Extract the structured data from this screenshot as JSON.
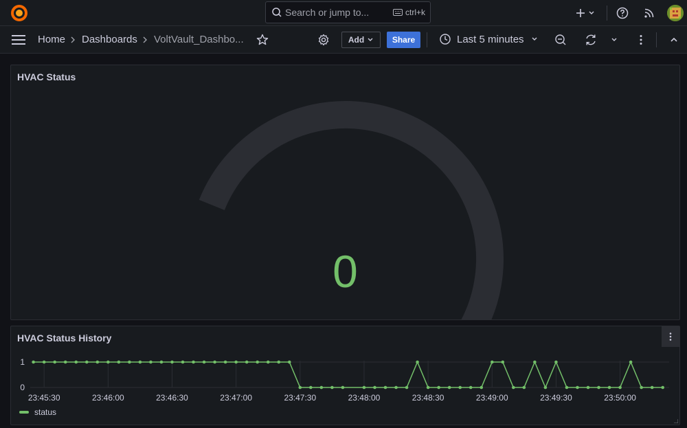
{
  "topbar": {
    "search_placeholder": "Search or jump to...",
    "search_shortcut": "ctrl+k"
  },
  "nav": {
    "breadcrumbs": [
      "Home",
      "Dashboards",
      "VoltVault_Dashbo..."
    ],
    "add_label": "Add",
    "share_label": "Share",
    "time_range": "Last 5 minutes"
  },
  "gauge_panel": {
    "title": "HVAC Status",
    "value": "0",
    "gauge_fraction": 0,
    "colors": {
      "track": "#2b2d33",
      "value": "#73bf69"
    }
  },
  "history_panel": {
    "title": "HVAC Status History",
    "legend": "status"
  },
  "chart_data": {
    "type": "line",
    "title": "HVAC Status History",
    "x_ticks": [
      "23:45:30",
      "23:46:00",
      "23:46:30",
      "23:47:00",
      "23:47:30",
      "23:48:00",
      "23:48:30",
      "23:49:00",
      "23:49:30",
      "23:50:00"
    ],
    "y_ticks": [
      "0",
      "1"
    ],
    "ylim": [
      0,
      1
    ],
    "grid": true,
    "legend_position": "bottom-left",
    "series": [
      {
        "name": "status",
        "color": "#73bf69",
        "points": [
          [
            "23:45:25",
            1
          ],
          [
            "23:45:30",
            1
          ],
          [
            "23:45:35",
            1
          ],
          [
            "23:45:40",
            1
          ],
          [
            "23:45:45",
            1
          ],
          [
            "23:45:50",
            1
          ],
          [
            "23:45:55",
            1
          ],
          [
            "23:46:00",
            1
          ],
          [
            "23:46:05",
            1
          ],
          [
            "23:46:10",
            1
          ],
          [
            "23:46:15",
            1
          ],
          [
            "23:46:20",
            1
          ],
          [
            "23:46:25",
            1
          ],
          [
            "23:46:30",
            1
          ],
          [
            "23:46:35",
            1
          ],
          [
            "23:46:40",
            1
          ],
          [
            "23:46:45",
            1
          ],
          [
            "23:46:50",
            1
          ],
          [
            "23:46:55",
            1
          ],
          [
            "23:47:00",
            1
          ],
          [
            "23:47:05",
            1
          ],
          [
            "23:47:10",
            1
          ],
          [
            "23:47:15",
            1
          ],
          [
            "23:47:20",
            1
          ],
          [
            "23:47:25",
            1
          ],
          [
            "23:47:30",
            0
          ],
          [
            "23:47:35",
            0
          ],
          [
            "23:47:40",
            0
          ],
          [
            "23:47:45",
            0
          ],
          [
            "23:47:50",
            0
          ],
          [
            "23:48:00",
            0
          ],
          [
            "23:48:05",
            0
          ],
          [
            "23:48:10",
            0
          ],
          [
            "23:48:15",
            0
          ],
          [
            "23:48:20",
            0
          ],
          [
            "23:48:25",
            1
          ],
          [
            "23:48:30",
            0
          ],
          [
            "23:48:35",
            0
          ],
          [
            "23:48:40",
            0
          ],
          [
            "23:48:45",
            0
          ],
          [
            "23:48:50",
            0
          ],
          [
            "23:48:55",
            0
          ],
          [
            "23:49:00",
            1
          ],
          [
            "23:49:05",
            1
          ],
          [
            "23:49:10",
            0
          ],
          [
            "23:49:15",
            0
          ],
          [
            "23:49:20",
            1
          ],
          [
            "23:49:25",
            0
          ],
          [
            "23:49:30",
            1
          ],
          [
            "23:49:35",
            0
          ],
          [
            "23:49:40",
            0
          ],
          [
            "23:49:45",
            0
          ],
          [
            "23:49:50",
            0
          ],
          [
            "23:49:55",
            0
          ],
          [
            "23:50:00",
            0
          ],
          [
            "23:50:05",
            1
          ],
          [
            "23:50:10",
            0
          ],
          [
            "23:50:15",
            0
          ],
          [
            "23:50:20",
            0
          ]
        ]
      }
    ]
  }
}
